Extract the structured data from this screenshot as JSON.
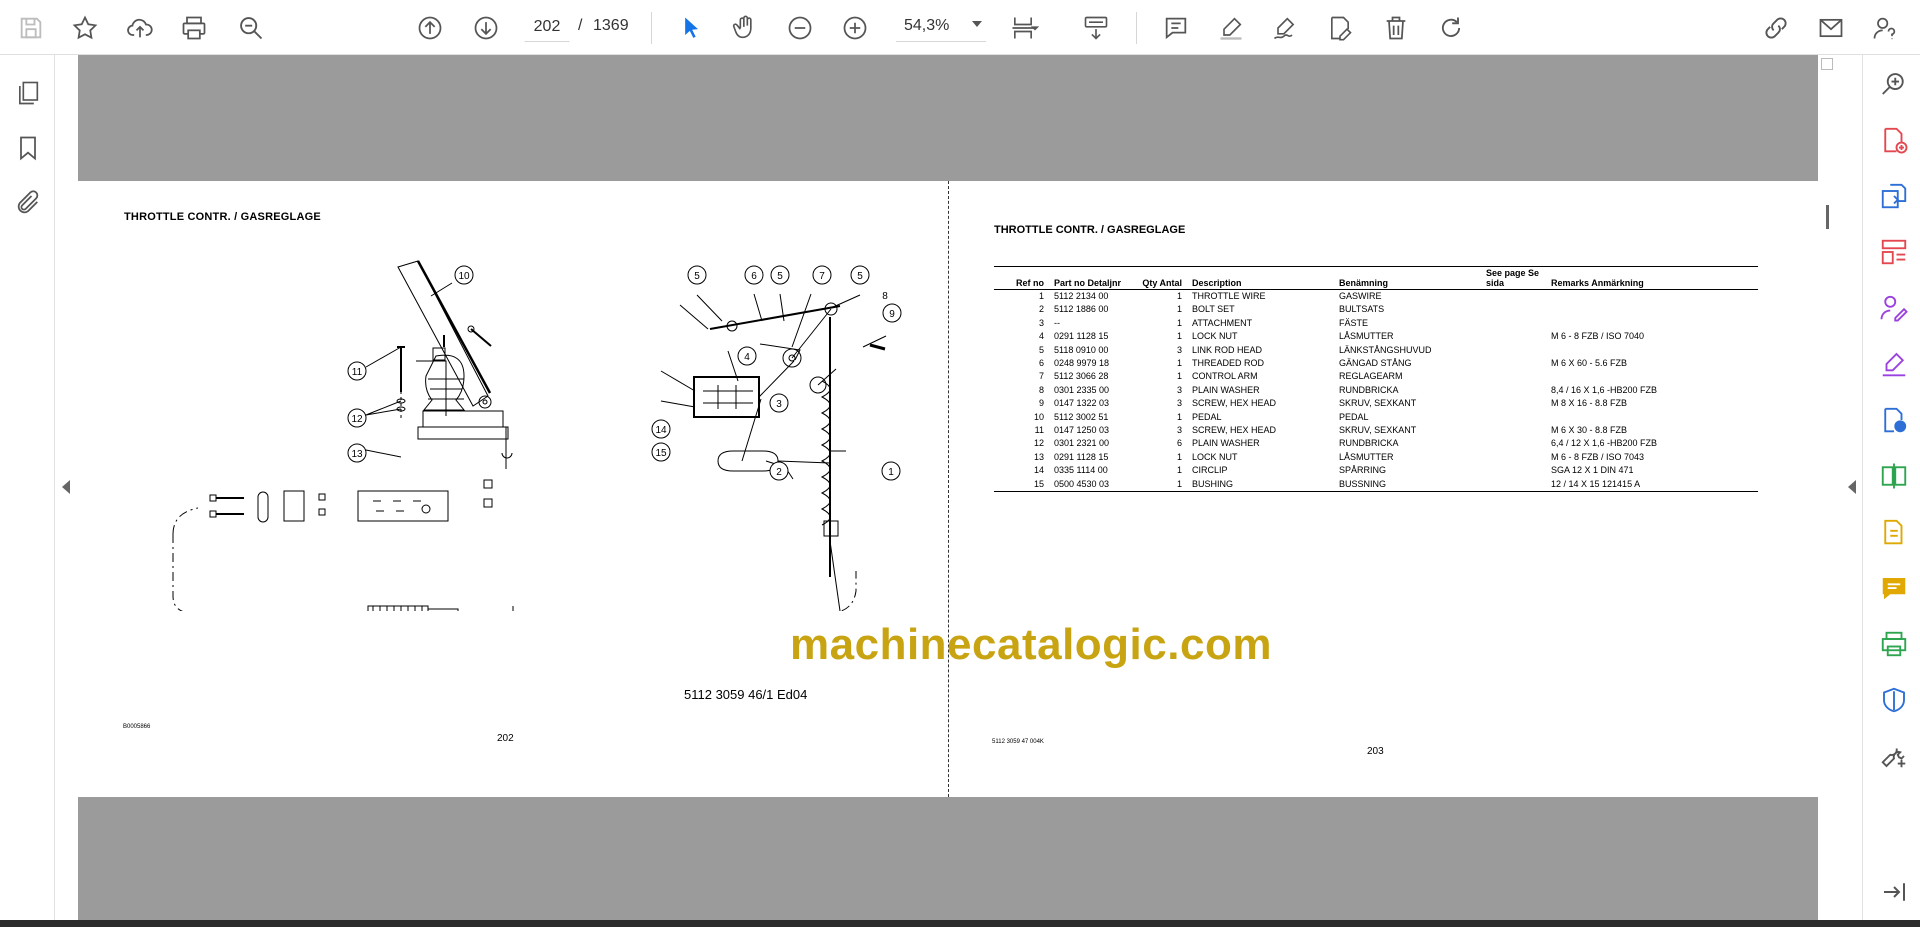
{
  "toolbar": {
    "page_current": "202",
    "page_separator": "/",
    "page_total": "1369",
    "zoom": "54,3%"
  },
  "left_page": {
    "title": "THROTTLE CONTR. / GASREGLAGE",
    "doc_number": "5112 3059 46/1  Ed04",
    "drawing_code": "B0005866",
    "page_number": "202",
    "callouts": [
      "1",
      "2",
      "3",
      "4",
      "5",
      "6",
      "7",
      "8",
      "9",
      "10",
      "11",
      "12",
      "13",
      "14",
      "15"
    ]
  },
  "right_page": {
    "title": "THROTTLE CONTR. / GASREGLAGE",
    "code": "5112 3059 47  004K",
    "page_number": "203",
    "headers": {
      "ref": "Ref no",
      "part": "Part no Detaljnr",
      "qty": "Qty Antal",
      "desc": "Description",
      "benamning": "Benämning",
      "see": "See page Se sida",
      "remarks": "Remarks Anmärkning"
    },
    "rows": [
      {
        "ref": "1",
        "part": "5112 2134 00",
        "qty": "1",
        "desc": "THROTTLE WIRE",
        "ben": "GASWIRE",
        "see": "",
        "rem": ""
      },
      {
        "ref": "2",
        "part": "5112 1886 00",
        "qty": "1",
        "desc": "BOLT SET",
        "ben": "BULTSATS",
        "see": "",
        "rem": ""
      },
      {
        "ref": "3",
        "part": "--",
        "qty": "1",
        "desc": "ATTACHMENT",
        "ben": "FÄSTE",
        "see": "",
        "rem": ""
      },
      {
        "ref": "4",
        "part": "0291 1128 15",
        "qty": "1",
        "desc": "LOCK NUT",
        "ben": "LÅSMUTTER",
        "see": "",
        "rem": "M  6 - 8 FZB / ISO 7040"
      },
      {
        "ref": "5",
        "part": "5118 0910 00",
        "qty": "3",
        "desc": "LINK ROD HEAD",
        "ben": "LÄNKSTÅNGSHUVUD",
        "see": "",
        "rem": ""
      },
      {
        "ref": "6",
        "part": "0248 9979 18",
        "qty": "1",
        "desc": "THREADED ROD",
        "ben": "GÄNGAD STÅNG",
        "see": "",
        "rem": "M 6 X 60 - 5.6 FZB"
      },
      {
        "ref": "7",
        "part": "5112 3066 28",
        "qty": "1",
        "desc": "CONTROL ARM",
        "ben": "REGLAGEARM",
        "see": "",
        "rem": ""
      },
      {
        "ref": "8",
        "part": "0301 2335 00",
        "qty": "3",
        "desc": "PLAIN WASHER",
        "ben": "RUNDBRICKA",
        "see": "",
        "rem": "8,4 / 16 X 1,6 -HB200 FZB"
      },
      {
        "ref": "9",
        "part": "0147 1322 03",
        "qty": "3",
        "desc": "SCREW, HEX HEAD",
        "ben": "SKRUV, SEXKANT",
        "see": "",
        "rem": "M 8 X 16 - 8.8 FZB"
      },
      {
        "ref": "10",
        "part": "5112 3002 51",
        "qty": "1",
        "desc": "PEDAL",
        "ben": "PEDAL",
        "see": "",
        "rem": ""
      },
      {
        "ref": "11",
        "part": "0147 1250 03",
        "qty": "3",
        "desc": "SCREW, HEX HEAD",
        "ben": "SKRUV, SEXKANT",
        "see": "",
        "rem": "M 6 X 30 - 8.8 FZB"
      },
      {
        "ref": "12",
        "part": "0301 2321 00",
        "qty": "6",
        "desc": "PLAIN WASHER",
        "ben": "RUNDBRICKA",
        "see": "",
        "rem": "6,4 / 12 X 1,6 -HB200 FZB"
      },
      {
        "ref": "13",
        "part": "0291 1128 15",
        "qty": "1",
        "desc": "LOCK NUT",
        "ben": "LÅSMUTTER",
        "see": "",
        "rem": "M  6 - 8 FZB / ISO 7043"
      },
      {
        "ref": "14",
        "part": "0335 1114 00",
        "qty": "1",
        "desc": "CIRCLIP",
        "ben": "SPÅRRING",
        "see": "",
        "rem": "SGA  12 X 1 DIN 471"
      },
      {
        "ref": "15",
        "part": "0500 4530 03",
        "qty": "1",
        "desc": "BUSHING",
        "ben": "BUSSNING",
        "see": "",
        "rem": "12 / 14 X 15 121415 A"
      }
    ]
  },
  "watermark": "machinecatalogic.com",
  "colors": {
    "viewer_bg": "#9b9b9b",
    "accent_blue": "#1473e6",
    "watermark": "#c8a412"
  }
}
